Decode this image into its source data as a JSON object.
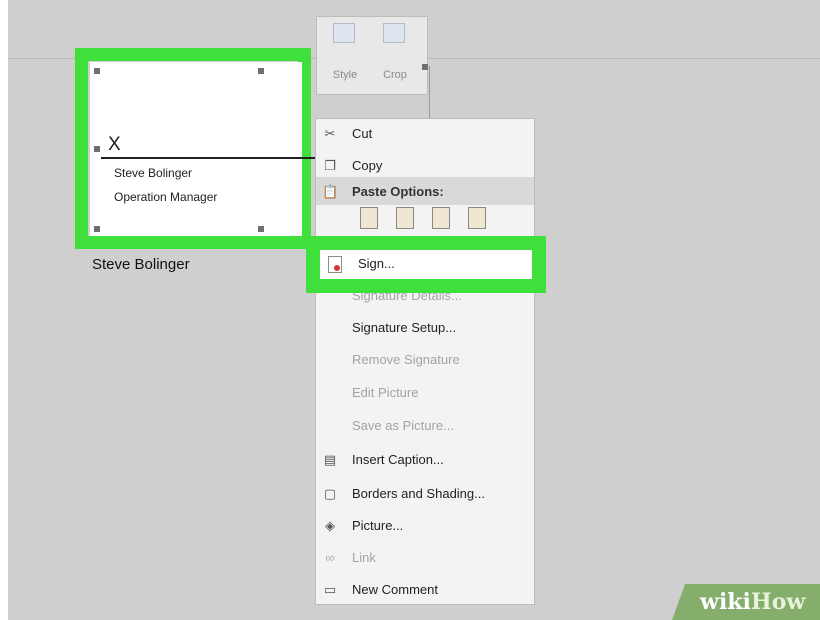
{
  "signature": {
    "mark": "X",
    "signer_name": "Steve Bolinger",
    "signer_title": "Operation Manager",
    "caption_below": "Steve Bolinger"
  },
  "picture_toolbar": {
    "style_label": "Style",
    "crop_label": "Crop"
  },
  "context_menu": {
    "cut": "Cut",
    "copy": "Copy",
    "paste_options": "Paste Options:",
    "sign": "Sign...",
    "signature_details": "Signature Details...",
    "signature_setup": "Signature Setup...",
    "remove_signature": "Remove Signature",
    "edit_picture": "Edit Picture",
    "save_as_picture": "Save as Picture...",
    "insert_caption": "Insert Caption...",
    "borders_and_shading": "Borders and Shading...",
    "picture": "Picture...",
    "link": "Link",
    "new_comment": "New Comment"
  },
  "watermark": {
    "part1": "wiki",
    "part2": "How"
  },
  "colors": {
    "highlight": "#3fe03b",
    "watermark_bg": "#85ad6b"
  }
}
